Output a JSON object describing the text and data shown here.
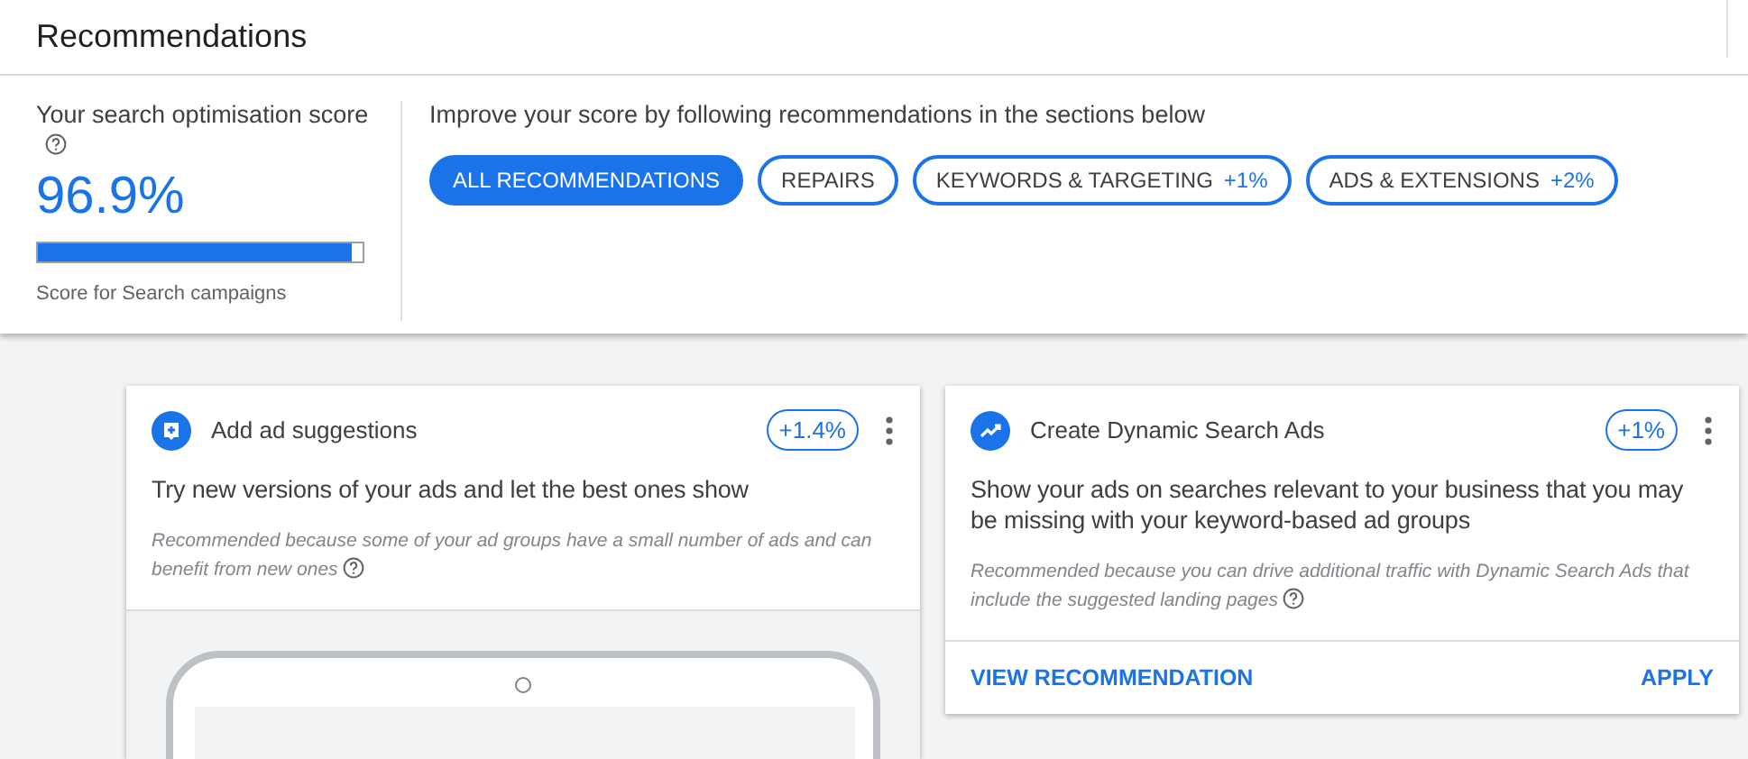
{
  "header": {
    "title": "Recommendations"
  },
  "score": {
    "label": "Your search optimisation score",
    "value": "96.9%",
    "level": 0.969,
    "caption": "Score for Search campaigns"
  },
  "filters": {
    "intro": "Improve your score by following recommendations in the sections below",
    "chips": [
      {
        "label": "ALL RECOMMENDATIONS",
        "selected": true
      },
      {
        "label": "REPAIRS",
        "selected": false
      },
      {
        "label": "KEYWORDS & TARGETING",
        "uplift": "+1%",
        "selected": false
      },
      {
        "label": "ADS & EXTENSIONS",
        "uplift": "+2%",
        "selected": false
      }
    ]
  },
  "cards": [
    {
      "kind": "ad-preview",
      "title": "Add ad suggestions",
      "uplift": "+1.4%",
      "headline": "Try new versions of your ads and let the best ones show",
      "reason": "Recommended because some of your ad groups have a small number of ads and can benefit from new ones"
    },
    {
      "kind": "actions",
      "title": "Create Dynamic Search Ads",
      "uplift": "+1%",
      "headline": "Show your ads on searches relevant to your business that you may be missing with your keyword-based ad groups",
      "reason": "Recommended because you can drive additional traffic with Dynamic Search Ads that include the suggested landing pages",
      "actions": [
        "VIEW RECOMMENDATION",
        "APPLY"
      ]
    }
  ]
}
